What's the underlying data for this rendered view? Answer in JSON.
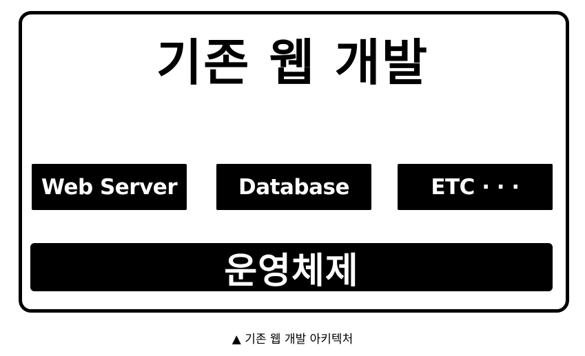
{
  "diagram": {
    "title": "기존 웹 개발",
    "components": [
      {
        "label": "Web Server"
      },
      {
        "label": "Database"
      },
      {
        "label": "ETC · · ·"
      }
    ],
    "os_layer": "운영체제"
  },
  "caption": "▲ 기존 웹 개발 아키텍처",
  "colors": {
    "box_fill": "#000000",
    "box_text": "#ffffff",
    "frame_border": "#000000",
    "background": "#ffffff"
  }
}
